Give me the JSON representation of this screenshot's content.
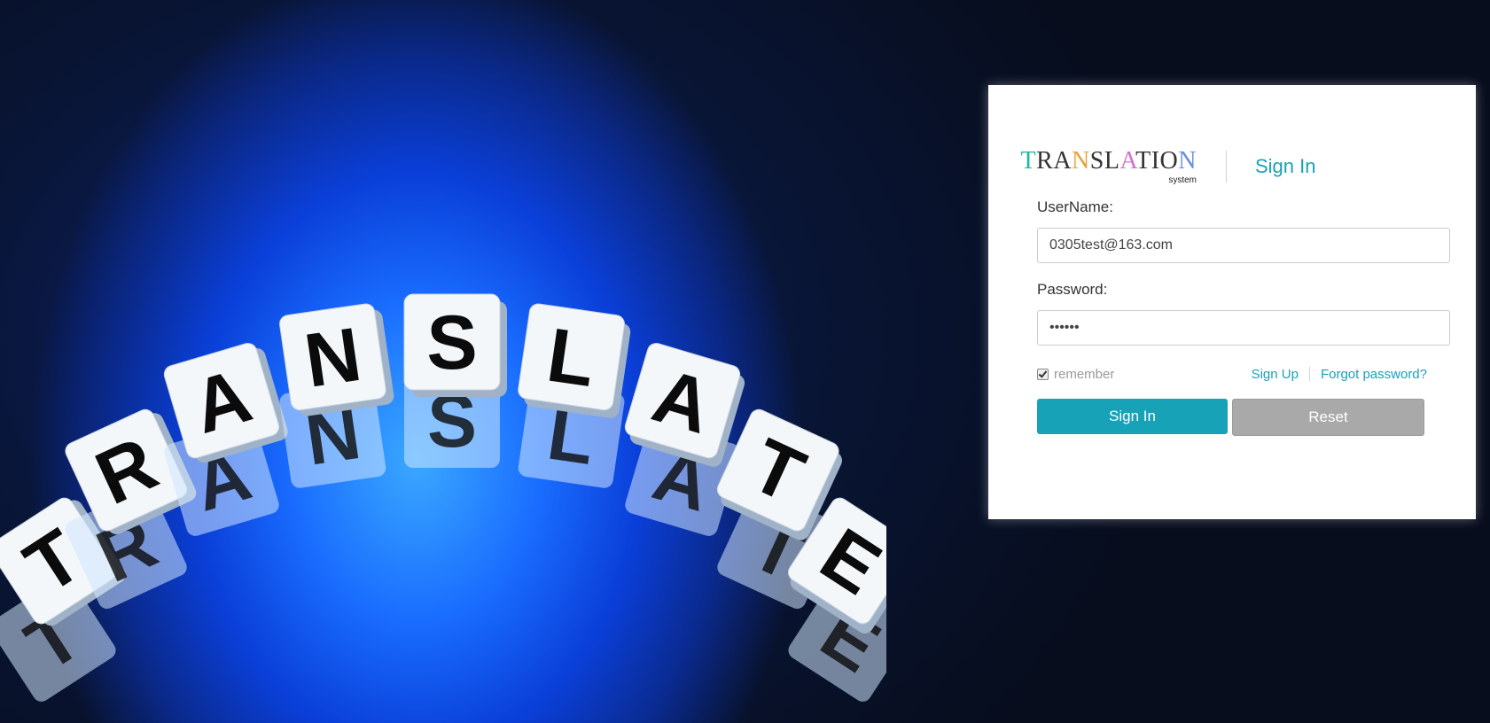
{
  "brand": {
    "logo_letters": [
      {
        "char": "T",
        "color": "#1fb5a0"
      },
      {
        "char": "R",
        "color": "#333333"
      },
      {
        "char": "A",
        "color": "#333333"
      },
      {
        "char": "N",
        "color": "#e8a23a"
      },
      {
        "char": "S",
        "color": "#333333"
      },
      {
        "char": "L",
        "color": "#333333"
      },
      {
        "char": "A",
        "color": "#d46fd0"
      },
      {
        "char": "T",
        "color": "#333333"
      },
      {
        "char": "I",
        "color": "#333333"
      },
      {
        "char": "O",
        "color": "#333333"
      },
      {
        "char": "N",
        "color": "#6a8fe0"
      }
    ],
    "logo_sub": "system",
    "title": "Sign In"
  },
  "form": {
    "username_label": "UserName:",
    "username_value": "0305test@163.com",
    "password_label": "Password:",
    "password_value": "••••••",
    "remember_label": "remember",
    "remember_checked": true,
    "signup_link": "Sign Up",
    "forgot_link": "Forgot password?",
    "signin_button": "Sign In",
    "reset_button": "Reset"
  },
  "hero": {
    "dice_letters_top": [
      "T",
      "R",
      "A",
      "N",
      "S",
      "L",
      "A",
      "T",
      "E"
    ]
  },
  "colors": {
    "accent": "#17a2b8",
    "reset_button": "#a9a9a9"
  }
}
